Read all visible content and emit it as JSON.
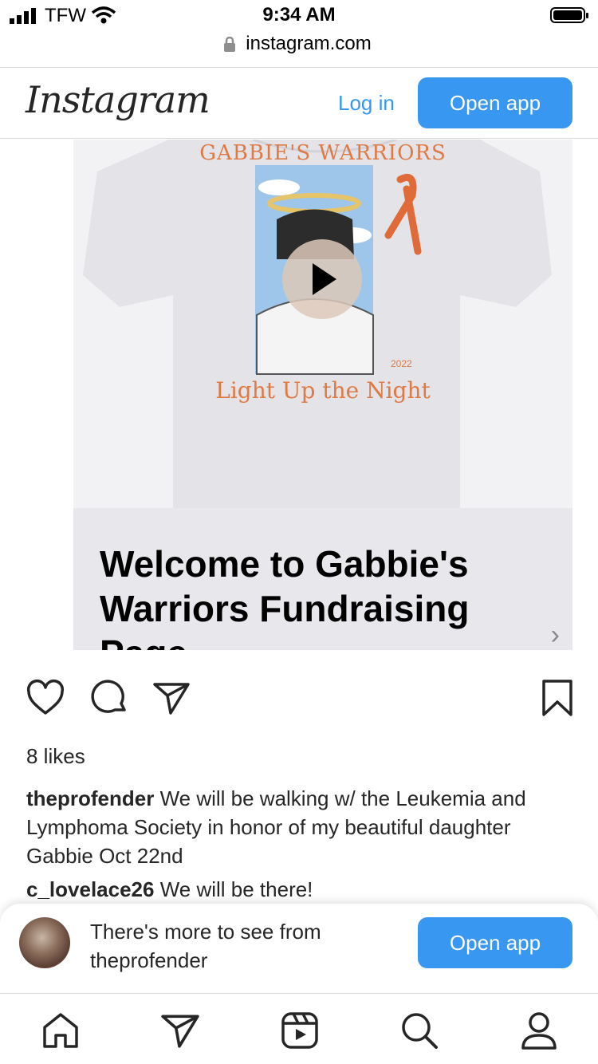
{
  "status_bar": {
    "carrier": "TFW",
    "time": "9:34 AM",
    "url": "instagram.com"
  },
  "header": {
    "logo": "Instagram",
    "login_label": "Log in",
    "open_app_label": "Open app"
  },
  "post": {
    "shirt_text_top": "GABBIE'S WARRIORS",
    "shirt_text_bottom": "Light Up the Night",
    "shirt_year": "2022",
    "card_title": "Welcome to Gabbie's Warriors Fundraising Page",
    "likes": "8 likes",
    "caption_user": "theprofender",
    "caption_text": " We will be walking w/ the Leukemia and Lymphoma Society in honor of my beautiful daughter Gabbie Oct 22nd",
    "comment_user": "c_lovelace26",
    "comment_text": " We will be there!"
  },
  "bottom_sheet": {
    "line1": "There's more to see from",
    "line2": "theprofender",
    "open_app_label": "Open app"
  },
  "nav": {
    "items": [
      "home-icon",
      "direct-icon",
      "reels-icon",
      "search-icon",
      "profile-icon"
    ]
  },
  "colors": {
    "accent": "#3897f0",
    "shirt_text": "#e07a44"
  }
}
